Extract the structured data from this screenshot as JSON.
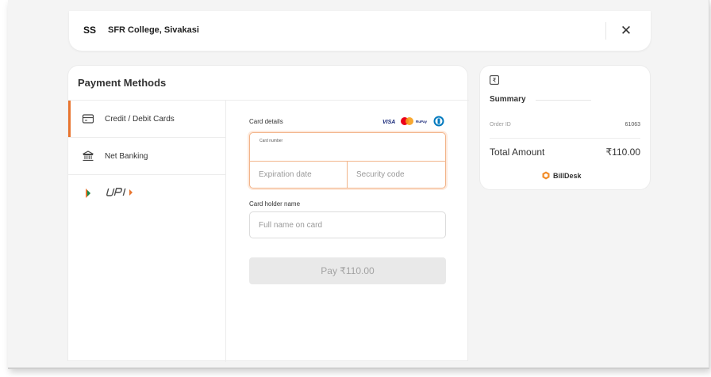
{
  "header": {
    "initials": "SS",
    "college_name": "SFR College, Sivakasi",
    "close_glyph": "✕"
  },
  "payment": {
    "title": "Payment Methods",
    "methods": [
      {
        "label": "Credit / Debit Cards",
        "icon": "card-icon",
        "active": true
      },
      {
        "label": "Net Banking",
        "icon": "bank-icon",
        "active": false
      },
      {
        "label": "UPI",
        "icon": "upi-logo",
        "active": false
      }
    ],
    "card_details_label": "Card details",
    "card_brands": [
      "visa-logo",
      "mastercard-logo",
      "rupay-logo",
      "diners-logo"
    ],
    "card_number_label": "Card number",
    "expiration_placeholder": "Expiration date",
    "security_placeholder": "Security code",
    "holder_label": "Card holder name",
    "holder_placeholder": "Full name on card",
    "pay_button": "Pay ₹110.00"
  },
  "summary": {
    "icon": "rupee-icon",
    "title": "Summary",
    "order_id_label": "Order ID",
    "order_id_value": "61063",
    "total_label": "Total Amount",
    "total_value": "₹110.00",
    "brand": "BillDesk"
  },
  "colors": {
    "accent": "#e8742e",
    "focus_border": "#f2b48a",
    "background": "#f4f4f4"
  }
}
